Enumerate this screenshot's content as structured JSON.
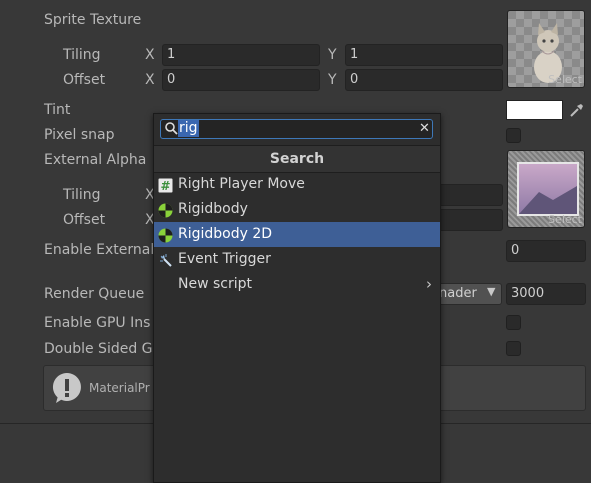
{
  "inspector": {
    "sprite_texture_label": "Sprite Texture",
    "tiling_label": "Tiling",
    "offset_label": "Offset",
    "x_label": "X",
    "y_label": "Y",
    "sprite_tiling_x": "1",
    "sprite_tiling_y": "1",
    "sprite_offset_x": "0",
    "sprite_offset_y": "0",
    "select_label": "Select",
    "tint_label": "Tint",
    "pixel_snap_label": "Pixel snap",
    "external_alpha_label": "External Alpha",
    "enable_external_label": "Enable External",
    "enable_external_value": "0",
    "render_queue_label": "Render Queue",
    "render_queue_dropdown": "nader",
    "render_queue_value": "3000",
    "enable_gpu_label": "Enable GPU Ins",
    "double_sided_label": "Double Sided G",
    "help_box_text": "MaterialPr"
  },
  "popup": {
    "search_value": "rig",
    "header": "Search",
    "items": [
      {
        "label": "Right Player Move",
        "icon": "script-icon"
      },
      {
        "label": "Rigidbody",
        "icon": "rigidbody-icon"
      },
      {
        "label": "Rigidbody 2D",
        "icon": "rigidbody2d-icon"
      },
      {
        "label": "Event Trigger",
        "icon": "event-trigger-icon"
      },
      {
        "label": "New script",
        "icon": ""
      }
    ]
  },
  "colors": {
    "background": "#383838",
    "selection": "#3e5f96",
    "search_focus": "#3e78b8"
  }
}
